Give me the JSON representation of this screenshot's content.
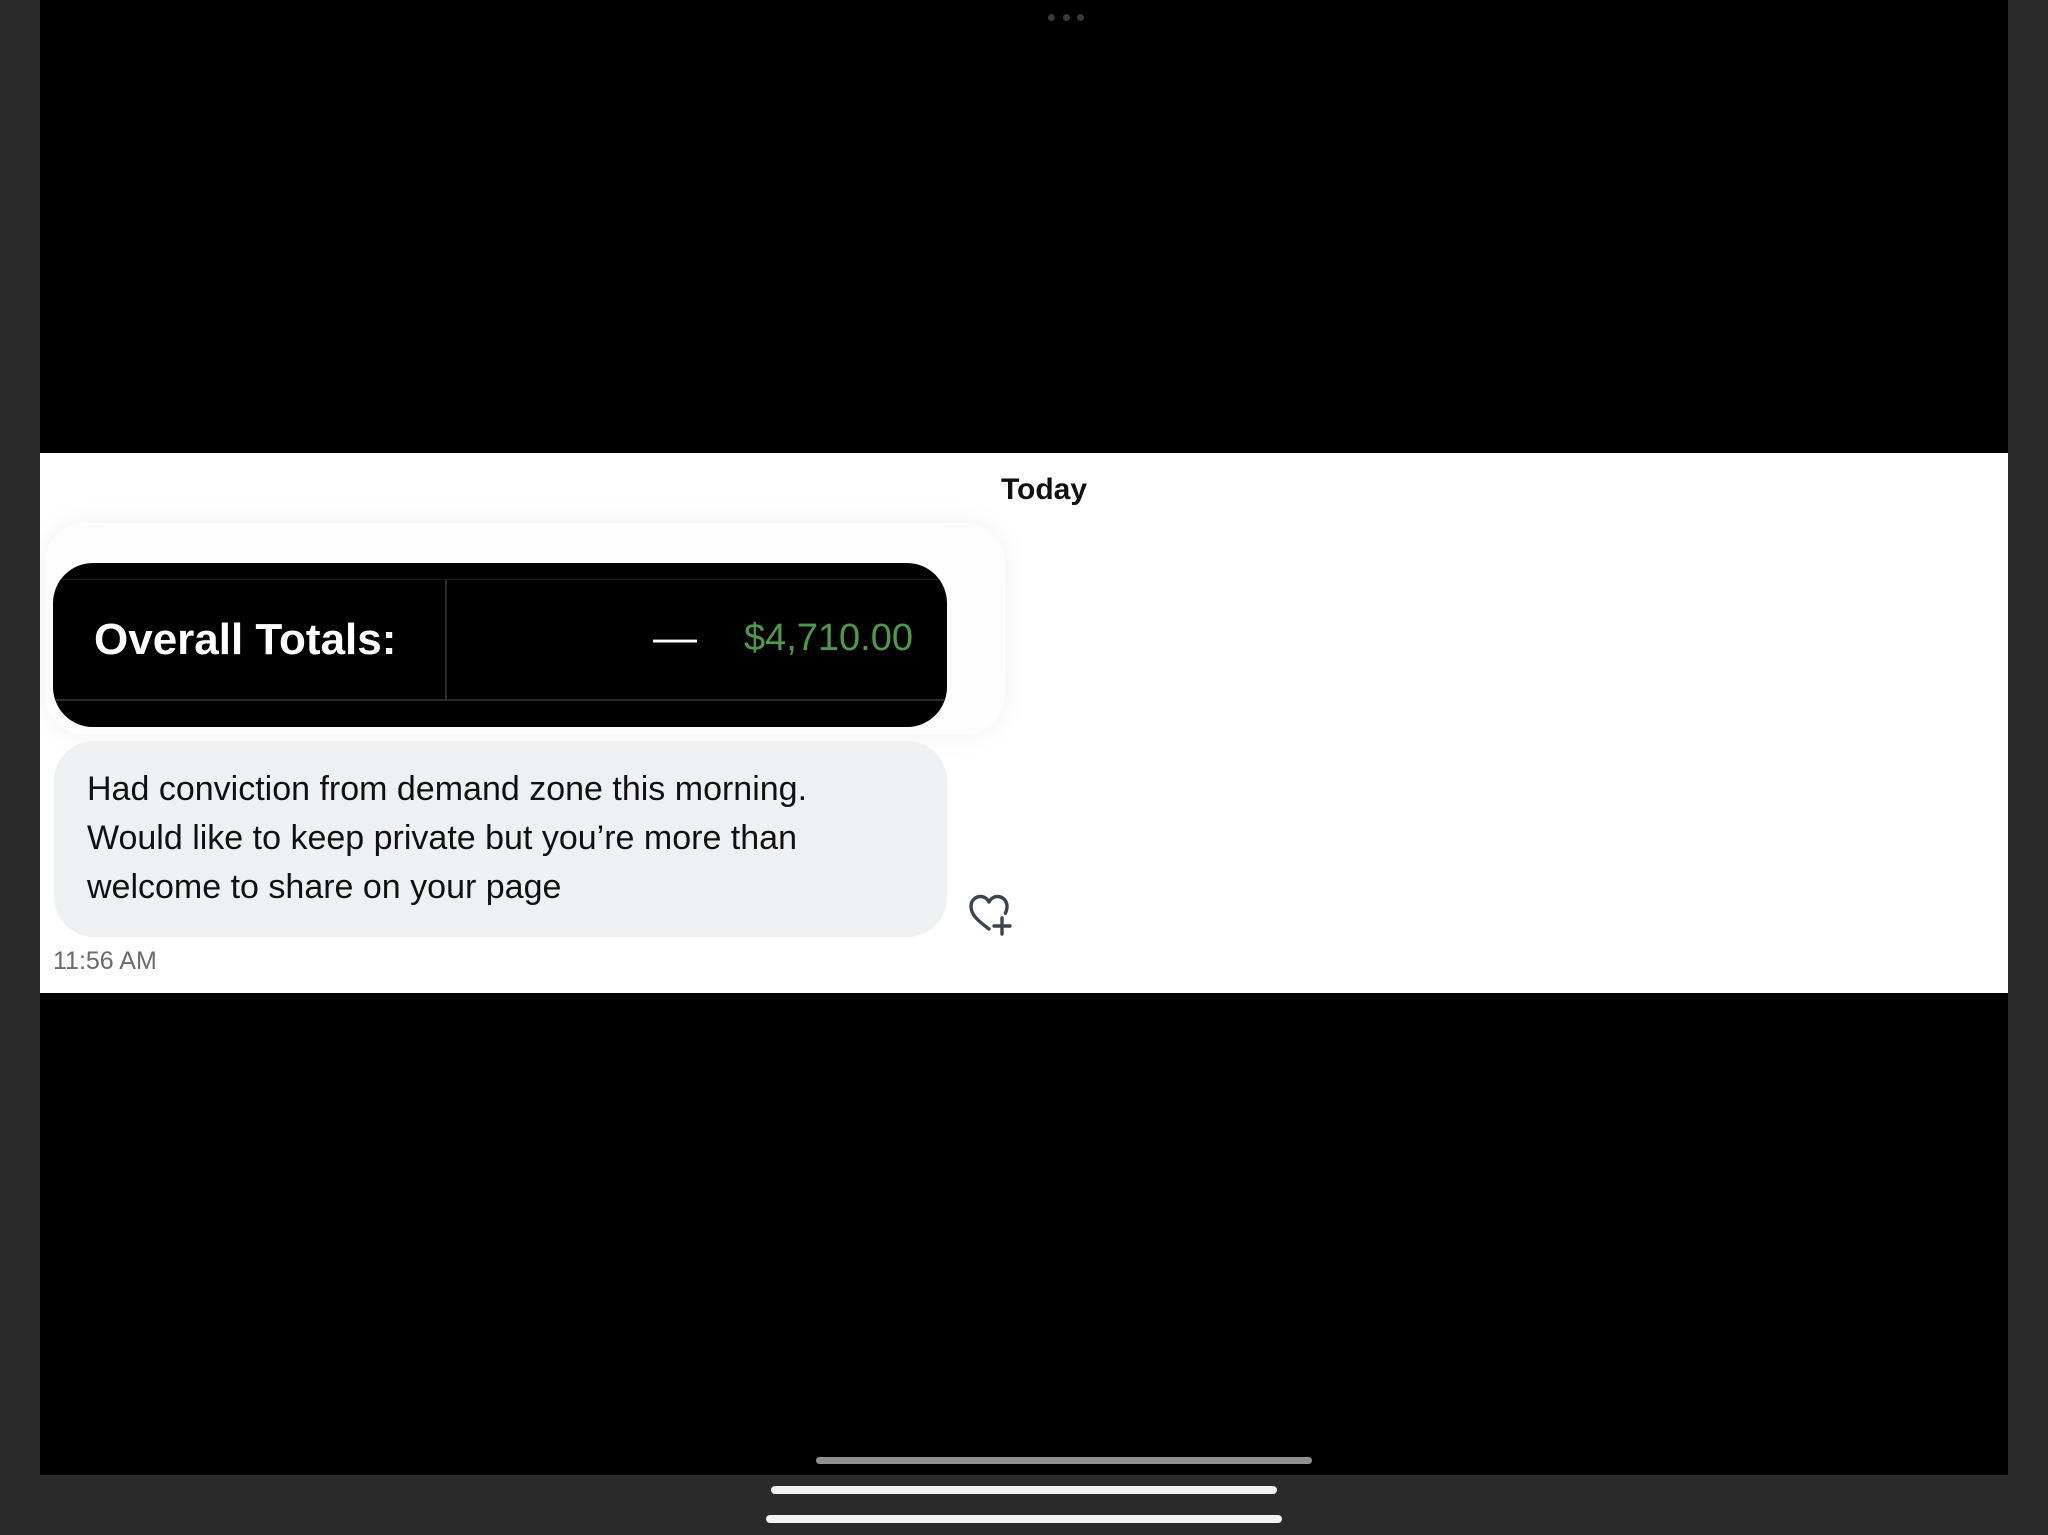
{
  "chat": {
    "date_header": "Today",
    "totals_card": {
      "label": "Overall Totals:",
      "dash": "—",
      "amount": "$4,710.00",
      "amount_color": "#4e9a4a"
    },
    "message": {
      "text": "Had conviction from demand zone this morning.\nWould like to keep private but you’re more than\nwelcome to share on your page",
      "timestamp": "11:56 AM"
    },
    "reaction_icon": "heart-plus-icon"
  }
}
